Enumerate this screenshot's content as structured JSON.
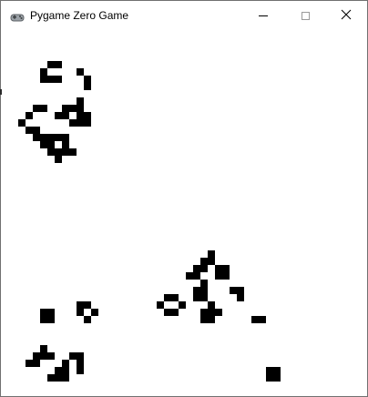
{
  "window": {
    "title": "Pygame Zero Game",
    "app_icon": "gamepad-icon",
    "controls": {
      "minimize_icon": "minimize-icon",
      "maximize_icon": "maximize-icon",
      "close_icon": "close-icon"
    }
  },
  "game": {
    "background_color": "#ffffff",
    "cell_color": "#000000"
  }
}
